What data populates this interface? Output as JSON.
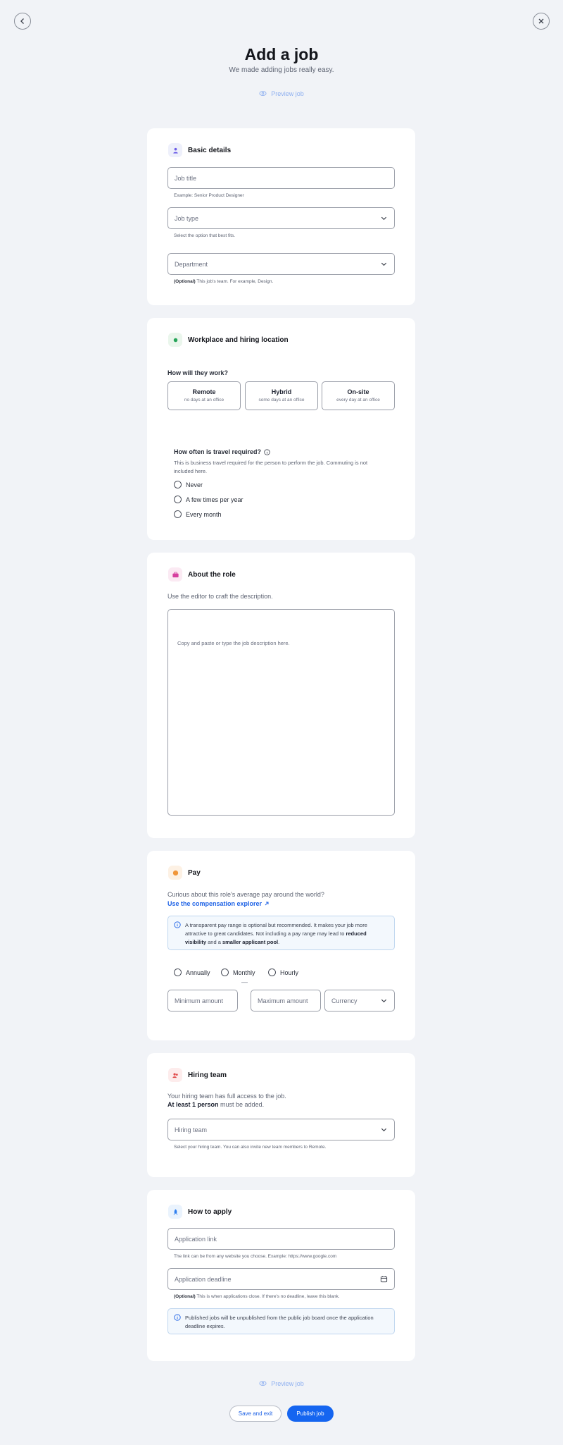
{
  "header": {
    "title": "Add a job",
    "subtitle": "We made adding jobs really easy.",
    "preview_label": "Preview job"
  },
  "basic_details": {
    "title": "Basic details",
    "job_title_placeholder": "Job title",
    "job_title_hint": "Example: Senior Product Designer",
    "job_type_placeholder": "Job type",
    "job_type_hint": "Select the option that best fits.",
    "department_placeholder": "Department",
    "department_hint_optional": "(Optional)",
    "department_hint": " This job's team. For example, Design."
  },
  "workplace": {
    "title": "Workplace and hiring location",
    "question": "How will they work?",
    "options": [
      {
        "label": "Remote",
        "sub": "no days at an office"
      },
      {
        "label": "Hybrid",
        "sub": "some days at an office"
      },
      {
        "label": "On-site",
        "sub": "every day at an office"
      }
    ],
    "travel_question": "How often is travel required?",
    "travel_desc": "This is business travel required for the person to perform the job. Commuting is not included here.",
    "travel_options": [
      "Never",
      "A few times per year",
      "Every month"
    ]
  },
  "about": {
    "title": "About the role",
    "desc": "Use the editor to craft the description.",
    "editor_placeholder": "Copy and paste or type the job description here."
  },
  "pay": {
    "title": "Pay",
    "question": "Curious about this role's average pay around the world?",
    "link": "Use the compensation explorer",
    "info_1": "A transparent pay range is optional but recommended. It makes your job more attractive to great candidates. Not including a pay range may lead to ",
    "info_bold_1": "reduced visibility",
    "info_2": " and a ",
    "info_bold_2": "smaller applicant pool",
    "info_3": ".",
    "frequency": [
      "Annually",
      "Monthly",
      "Hourly"
    ],
    "min_placeholder": "Minimum amount",
    "separator": "—",
    "max_placeholder": "Maximum amount",
    "currency_placeholder": "Currency"
  },
  "hiring_team": {
    "title": "Hiring team",
    "desc_1": "Your hiring team has full access to the job.",
    "desc_bold": "At least 1 person",
    "desc_2": " must be added.",
    "placeholder": "Hiring team",
    "hint": "Select your hiring team. You can also invite new team members to Remote."
  },
  "apply": {
    "title": "How to apply",
    "link_placeholder": "Application link",
    "link_hint": "The link can be from any website you choose. Example: https://www.google.com",
    "deadline_placeholder": "Application deadline",
    "deadline_hint_optional": "(Optional)",
    "deadline_hint": " This is when applications close. If there's no deadline, leave this blank.",
    "info": "Published jobs will be unpublished from the public job board once the application deadline expires."
  },
  "footer": {
    "preview_label": "Preview job",
    "save_label": "Save and exit",
    "publish_label": "Publish job"
  },
  "colors": {
    "accent": "#1565f0",
    "background": "#f1f3f7",
    "card": "#ffffff"
  }
}
